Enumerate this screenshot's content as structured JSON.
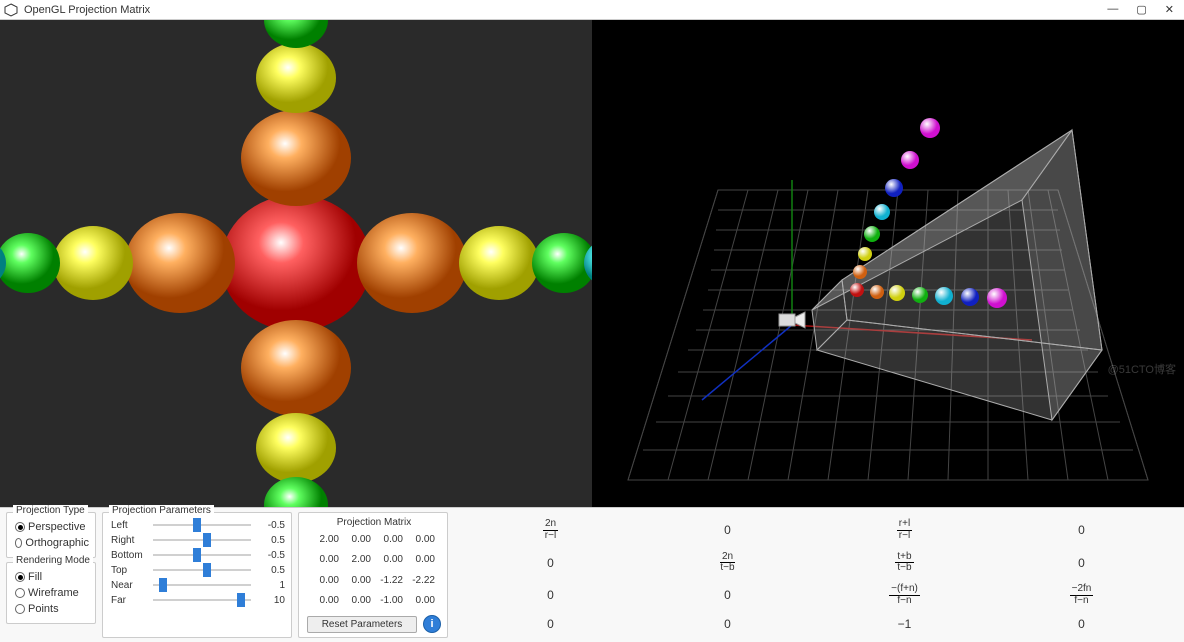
{
  "window": {
    "title": "OpenGL Projection Matrix",
    "min": "—",
    "max": "▢",
    "close": "✕"
  },
  "projection_type": {
    "title": "Projection Type",
    "options": [
      {
        "label": "Perspective",
        "checked": true
      },
      {
        "label": "Orthographic",
        "checked": false
      }
    ]
  },
  "rendering_mode": {
    "title": "Rendering Mode",
    "options": [
      {
        "label": "Fill",
        "checked": true
      },
      {
        "label": "Wireframe",
        "checked": false
      },
      {
        "label": "Points",
        "checked": false
      }
    ]
  },
  "projection_params": {
    "title": "Projection Parameters",
    "rows": [
      {
        "label": "Left",
        "value": "-0.5",
        "pos": 45
      },
      {
        "label": "Right",
        "value": "0.5",
        "pos": 55
      },
      {
        "label": "Bottom",
        "value": "-0.5",
        "pos": 45
      },
      {
        "label": "Top",
        "value": "0.5",
        "pos": 55
      },
      {
        "label": "Near",
        "value": "1",
        "pos": 10
      },
      {
        "label": "Far",
        "value": "10",
        "pos": 90
      }
    ]
  },
  "matrix": {
    "title": "Projection Matrix",
    "cells": [
      "2.00",
      "0.00",
      "0.00",
      "0.00",
      "0.00",
      "2.00",
      "0.00",
      "0.00",
      "0.00",
      "0.00",
      "-1.22",
      "-2.22",
      "0.00",
      "0.00",
      "-1.00",
      "0.00"
    ],
    "reset": "Reset Parameters"
  },
  "formula": {
    "r0": {
      "a": "2n",
      "ad": "r−l",
      "b": "0",
      "c": "r+l",
      "cd": "r−l",
      "d": "0"
    },
    "r1": {
      "a": "0",
      "b": "2n",
      "bd": "t−b",
      "c": "t+b",
      "cd": "t−b",
      "d": "0"
    },
    "r2": {
      "a": "0",
      "b": "0",
      "c": "−(f+n)",
      "cd": "f−n",
      "d": "−2fn",
      "dd": "f−n"
    },
    "r3": {
      "a": "0",
      "b": "0",
      "c": "−1",
      "d": "0"
    }
  },
  "watermark": "@51CTO博客",
  "colors": {
    "red": "#e02020",
    "orange": "#f07020",
    "yellow": "#f0e020",
    "green": "#20d020",
    "cyan": "#20d0e0",
    "blue": "#2030d0",
    "magenta": "#e020e0"
  }
}
